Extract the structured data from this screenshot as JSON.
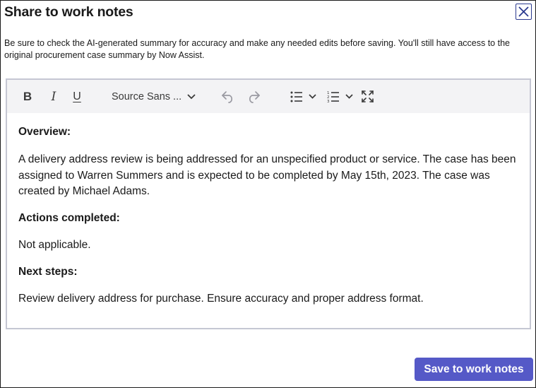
{
  "dialog": {
    "title": "Share to work notes",
    "description": "Be sure to check the AI-generated summary for accuracy and make any needed edits before saving. You'll still have access to the original procurement case summary by Now Assist.",
    "close_icon": "close-icon"
  },
  "toolbar": {
    "bold_label": "B",
    "italic_label": "I",
    "underline_label": "U",
    "font_label": "Source Sans ...",
    "icons": [
      "undo-icon",
      "redo-icon",
      "bullet-list-icon",
      "numbered-list-icon",
      "fullscreen-icon"
    ]
  },
  "content": {
    "overview_heading": "Overview:",
    "overview_text": "A delivery address review is being addressed for an unspecified product or service. The case has been assigned to Warren Summers and is expected to be completed by May 15th, 2023. The case was created by Michael Adams.",
    "actions_heading": "Actions completed:",
    "actions_text": "Not applicable.",
    "next_heading": "Next steps:",
    "next_text": "Review delivery address for purchase. Ensure accuracy and proper address format."
  },
  "footer": {
    "save_label": "Save to work notes"
  },
  "colors": {
    "accent": "#5559c7",
    "close_border": "#2b3a8f",
    "editor_border": "#c5c7d3",
    "toolbar_bg": "#f3f3f5"
  }
}
